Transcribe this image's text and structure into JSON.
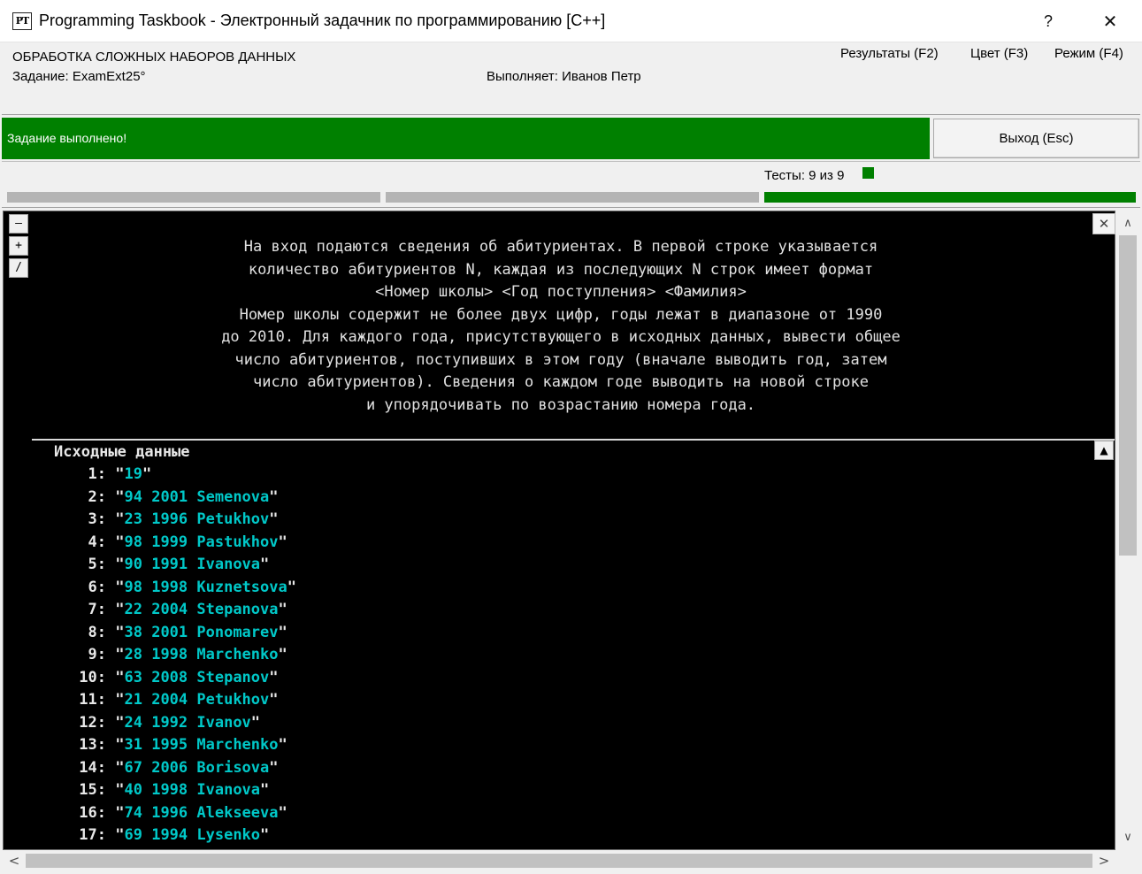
{
  "window": {
    "icon_text": "PT",
    "title": "Programming Taskbook - Электронный задачник по программированию [C++]",
    "help_label": "?",
    "close_label": "✕"
  },
  "info": {
    "section": "ОБРАБОТКА СЛОЖНЫХ НАБОРОВ ДАННЫХ",
    "task": "Задание: ExamExt25°",
    "student": "Выполняет: Иванов Петр",
    "menu": {
      "results": "Результаты (F2)",
      "color": "Цвет (F3)",
      "mode": "Режим (F4)"
    }
  },
  "status": {
    "message": "Задание выполнено!",
    "exit_label": "Выход (Esc)",
    "color": "#008000"
  },
  "tests": {
    "label": "Тесты:  9 из 9",
    "passed": 9,
    "total": 9,
    "segments": [
      {
        "color": "#b4b4b4"
      },
      {
        "color": "#b4b4b4"
      },
      {
        "color": "#008000"
      }
    ]
  },
  "console": {
    "side_buttons": [
      "–",
      "+",
      "/"
    ],
    "close_label": "✕",
    "up_label": "▲",
    "task_lines": [
      "На вход подаются сведения об абитуриентах. В первой строке указывается",
      "количество абитуриентов N, каждая из последующих N строк имеет формат",
      "<Номер школы> <Год поступления> <Фамилия>",
      "Номер школы содержит не более двух цифр, годы лежат в диапазоне от 1990",
      "до 2010. Для каждого года, присутствующего в исходных данных, вывести общее",
      "число абитуриентов, поступивших в этом году (вначале выводить год, затем",
      "число абитуриентов). Сведения о каждом годе выводить на новой строке",
      "и упорядочивать по возрастанию номера года."
    ],
    "section_title": "Исходные данные",
    "rows": [
      {
        "num": "1:",
        "value": "19"
      },
      {
        "num": "2:",
        "value": "94 2001 Semenova"
      },
      {
        "num": "3:",
        "value": "23 1996 Petukhov"
      },
      {
        "num": "4:",
        "value": "98 1999 Pastukhov"
      },
      {
        "num": "5:",
        "value": "90 1991 Ivanova"
      },
      {
        "num": "6:",
        "value": "98 1998 Kuznetsova"
      },
      {
        "num": "7:",
        "value": "22 2004 Stepanova"
      },
      {
        "num": "8:",
        "value": "38 2001 Ponomarev"
      },
      {
        "num": "9:",
        "value": "28 1998 Marchenko"
      },
      {
        "num": "10:",
        "value": "63 2008 Stepanov"
      },
      {
        "num": "11:",
        "value": "21 2004 Petukhov"
      },
      {
        "num": "12:",
        "value": "24 1992 Ivanov"
      },
      {
        "num": "13:",
        "value": "31 1995 Marchenko"
      },
      {
        "num": "14:",
        "value": "67 2006 Borisova"
      },
      {
        "num": "15:",
        "value": "40 1998 Ivanova"
      },
      {
        "num": "16:",
        "value": "74 1996 Alekseeva"
      },
      {
        "num": "17:",
        "value": "69 1994 Lysenko"
      }
    ]
  },
  "scrollbars": {
    "up": "∧",
    "down": "∨",
    "left": "<",
    "right": ">"
  }
}
